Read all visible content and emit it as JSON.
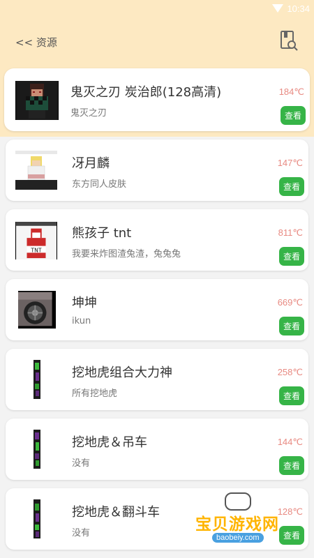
{
  "status": {
    "time": "10:34"
  },
  "header": {
    "back_label": "<< 资源"
  },
  "items": [
    {
      "title": "鬼灭之刃 炭治郎(128高清)",
      "subtitle": "鬼灭之刃",
      "temp": "184℃",
      "button": "查看",
      "thumb": "tanjiro-skin"
    },
    {
      "title": "冴月麟",
      "subtitle": "东方同人皮肤",
      "temp": "147℃",
      "button": "查看",
      "thumb": "blonde-skin-screenshot"
    },
    {
      "title": "熊孩子 tnt",
      "subtitle": "我要来炸图渣兔渣，兔兔兔",
      "temp": "811℃",
      "button": "查看",
      "thumb": "tnt-skin"
    },
    {
      "title": "坤坤",
      "subtitle": "ikun",
      "temp": "669℃",
      "button": "查看",
      "thumb": "wheel-image"
    },
    {
      "title": "挖地虎组合大力神",
      "subtitle": "所有挖地虎",
      "temp": "258℃",
      "button": "查看",
      "thumb": "green-strip"
    },
    {
      "title": "挖地虎＆吊车",
      "subtitle": "没有",
      "temp": "144℃",
      "button": "查看",
      "thumb": "green-strip"
    },
    {
      "title": "挖地虎＆翻斗车",
      "subtitle": "没有",
      "temp": "128℃",
      "button": "查看",
      "thumb": "green-strip"
    }
  ],
  "watermark": {
    "text": "宝贝游戏网",
    "url": "baobeiy.com"
  }
}
